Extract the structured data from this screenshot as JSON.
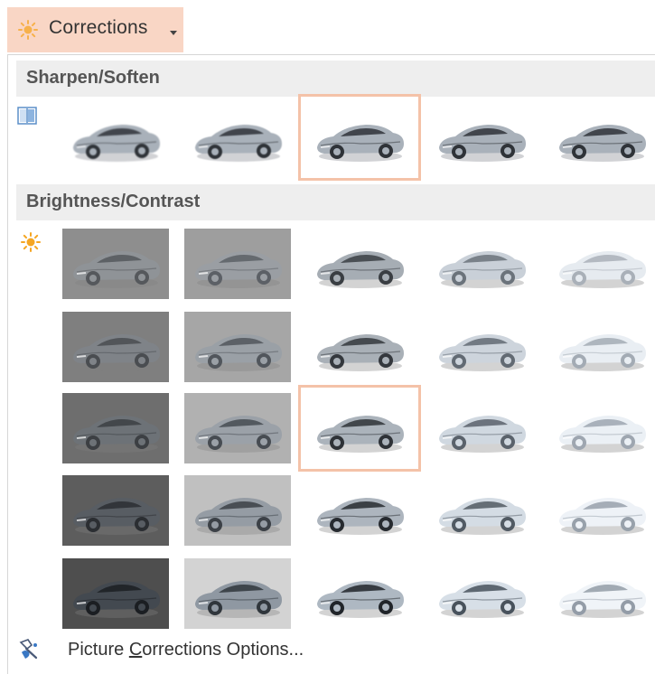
{
  "ribbon": {
    "button_label": "Corrections",
    "button_icon": "sun-icon",
    "button_bg": "#f9d6c5"
  },
  "sections": {
    "sharpen": {
      "title": "Sharpen/Soften",
      "icon": "sharpen-icon",
      "selected_index": 2
    },
    "brightness": {
      "title": "Brightness/Contrast",
      "icon": "brightness-sun-icon",
      "rows": 5,
      "cols": 5,
      "selected": [
        2,
        2
      ]
    }
  },
  "footer": {
    "label_prefix": "Picture ",
    "label_accel": "C",
    "label_suffix": "orrections Options...",
    "icon": "picture-corrections-icon"
  },
  "colors": {
    "selection_outline": "#f4c2a8",
    "section_header_bg": "#eeeeee",
    "header_text": "#555555",
    "accent_sun": "#f5a623"
  }
}
